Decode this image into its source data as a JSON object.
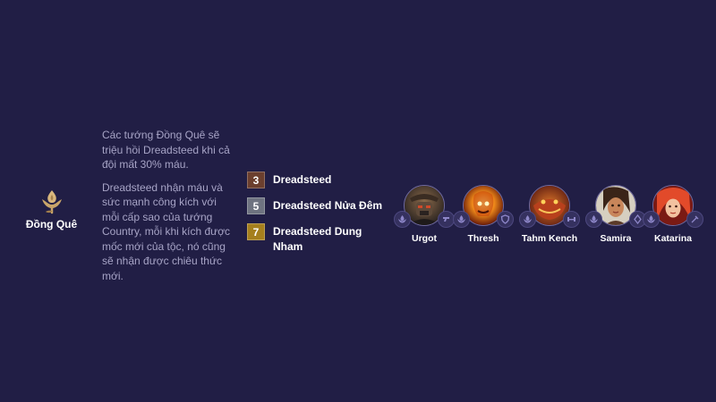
{
  "trait": {
    "name": "Đồng Quê",
    "icon": "rose-sprout-icon",
    "accent_color": "#d9b77d"
  },
  "description": {
    "paragraph1": "Các tướng Đồng Quê sẽ triệu hồi Dreadsteed khi cả đội mất 30% máu.",
    "paragraph2": "Dreadsteed nhận máu và sức mạnh công kích với mỗi cấp sao của tướng Country, mỗi khi kích được mốc mới của tộc, nó cũng sẽ nhận được chiêu thức mới."
  },
  "tiers": [
    {
      "count": "3",
      "name": "Dreadsteed",
      "color": "#6b3f2e"
    },
    {
      "count": "5",
      "name": "Dreadsteed Nửa Đêm",
      "color": "#6e7380"
    },
    {
      "count": "7",
      "name": "Dreadsteed Dung Nham",
      "color": "#a57f1d"
    }
  ],
  "champions": [
    {
      "name": "Urgot",
      "badges": [
        "trait-icon",
        "trait-icon"
      ]
    },
    {
      "name": "Thresh",
      "badges": [
        "trait-icon",
        "trait-icon"
      ]
    },
    {
      "name": "Tahm Kench",
      "badges": [
        "trait-icon",
        "trait-icon"
      ]
    },
    {
      "name": "Samira",
      "badges": [
        "trait-icon",
        "trait-icon"
      ]
    },
    {
      "name": "Katarina",
      "badges": [
        "trait-icon",
        "trait-icon"
      ]
    }
  ]
}
